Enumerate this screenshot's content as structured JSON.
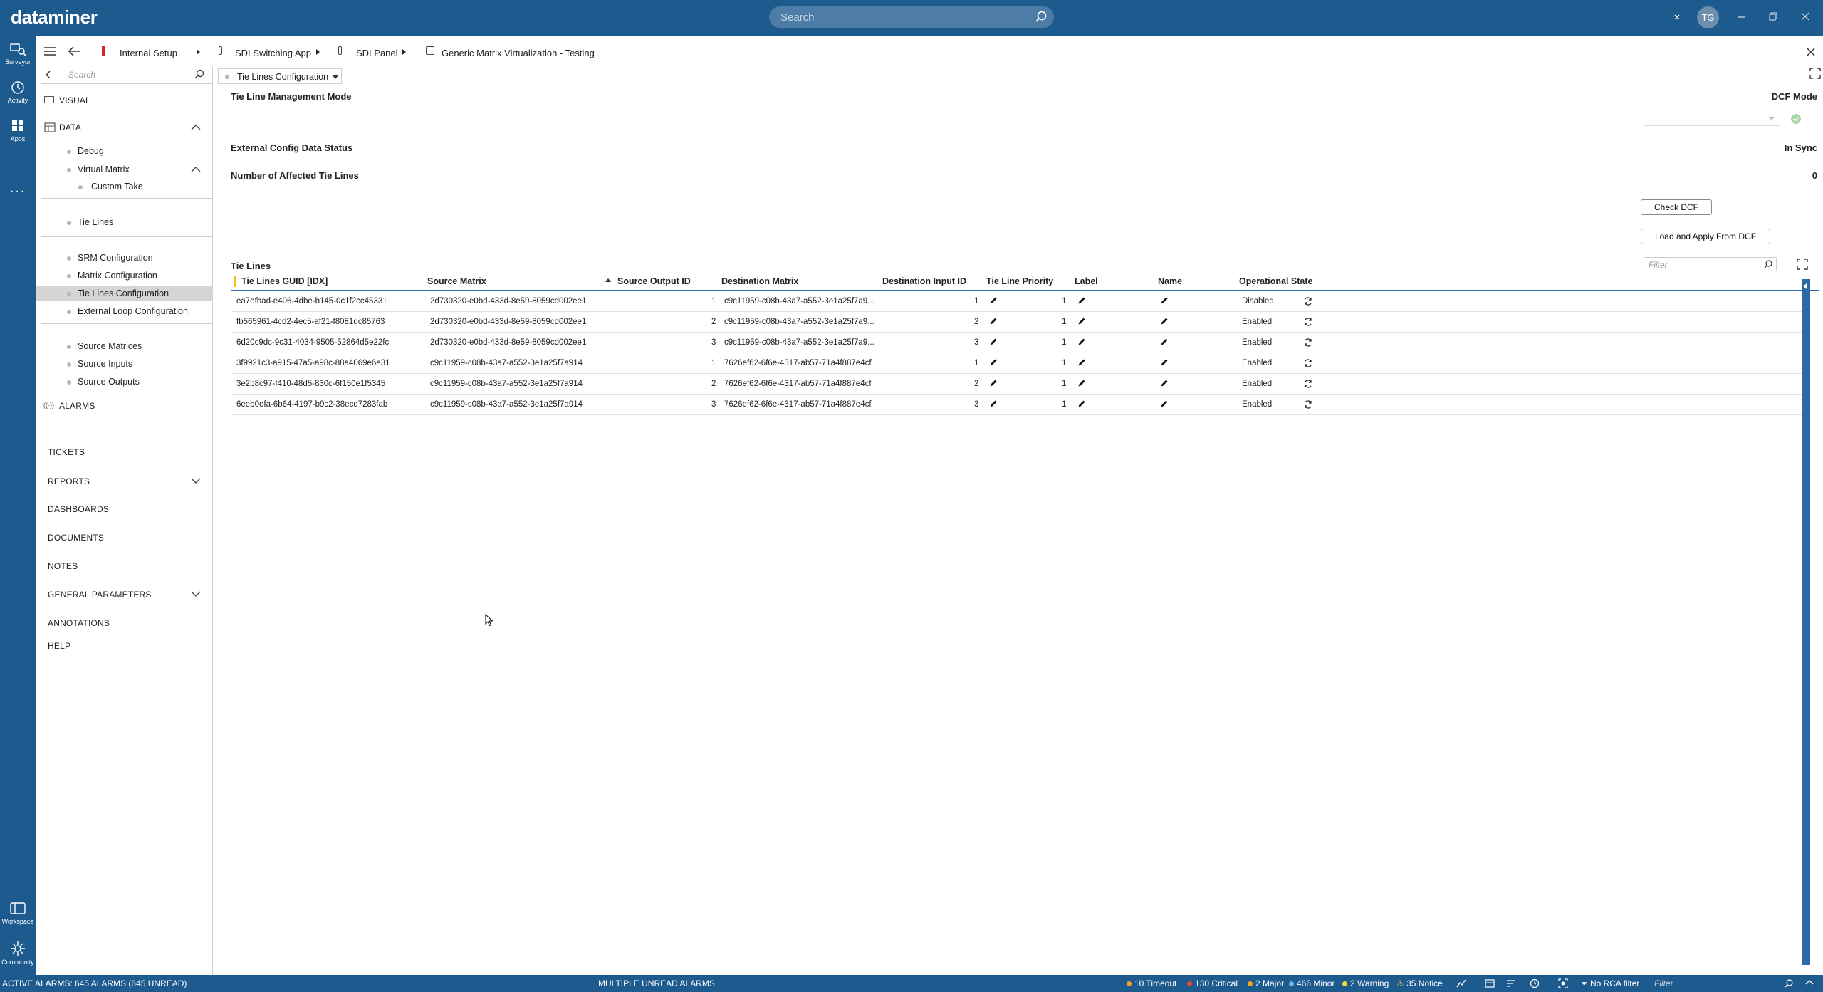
{
  "app": {
    "logo": "dataminer",
    "search_placeholder": "Search",
    "avatar_initials": "TG",
    "brand_color": "#1d5a8e"
  },
  "rail": {
    "items": [
      {
        "label": "Surveyor",
        "icon": "surveyor-icon"
      },
      {
        "label": "Activity",
        "icon": "activity-icon"
      },
      {
        "label": "Apps",
        "icon": "apps-icon"
      },
      {
        "label": "Workspace",
        "icon": "workspace-icon"
      },
      {
        "label": "Community",
        "icon": "community-icon"
      }
    ]
  },
  "breadcrumb": {
    "items": [
      "Internal Setup",
      "SDI Switching App",
      "SDI Panel",
      "Generic Matrix Virtualization - Testing"
    ]
  },
  "nav": {
    "search_placeholder": "Search",
    "visual": "VISUAL",
    "data": "DATA",
    "items": {
      "debug": "Debug",
      "virtual_matrix": "Virtual Matrix",
      "custom_take": "Custom Take",
      "tie_lines": "Tie Lines",
      "srm_configuration": "SRM Configuration",
      "matrix_configuration": "Matrix Configuration",
      "tie_lines_configuration": "Tie Lines Configuration",
      "external_loop_configuration": "External Loop Configuration",
      "source_matrices": "Source Matrices",
      "source_inputs": "Source Inputs",
      "source_outputs": "Source Outputs"
    },
    "alarms": "ALARMS",
    "sections": {
      "tickets": "TICKETS",
      "reports": "REPORTS",
      "dashboards": "DASHBOARDS",
      "documents": "DOCUMENTS",
      "notes": "NOTES",
      "general_parameters": "GENERAL PARAMETERS",
      "annotations": "ANNOTATIONS",
      "help": "HELP"
    }
  },
  "page": {
    "tab_dropdown": "Tie Lines Configuration",
    "fields": {
      "mode_label": "Tie Line Management Mode",
      "mode_value": "DCF Mode",
      "status_label": "External Config Data Status",
      "status_value": "In Sync",
      "affected_label": "Number of Affected Tie Lines",
      "affected_value": "0"
    },
    "buttons": {
      "check_dcf": "Check DCF",
      "load_apply": "Load and Apply From DCF"
    },
    "tie_lines_title": "Tie Lines",
    "filter_placeholder": "Filter"
  },
  "grid": {
    "columns": [
      "Tie Lines GUID [IDX]",
      "Source Matrix",
      "Source Output ID",
      "Destination Matrix",
      "Destination Input ID",
      "Tie Line Priority",
      "Label",
      "Name",
      "Operational State"
    ],
    "rows": [
      {
        "guid": "ea7efbad-e406-4dbe-b145-0c1f2cc45331",
        "source_matrix": "2d730320-e0bd-433d-8e59-8059cd002ee1",
        "source_output": "1",
        "dest_matrix": "c9c11959-c08b-43a7-a552-3e1a25f7a9...",
        "dest_input": "1",
        "priority": "1",
        "state": "Disabled"
      },
      {
        "guid": "fb565961-4cd2-4ec5-af21-f8081dc85763",
        "source_matrix": "2d730320-e0bd-433d-8e59-8059cd002ee1",
        "source_output": "2",
        "dest_matrix": "c9c11959-c08b-43a7-a552-3e1a25f7a9...",
        "dest_input": "2",
        "priority": "1",
        "state": "Enabled"
      },
      {
        "guid": "6d20c9dc-9c31-4034-9505-52864d5e22fc",
        "source_matrix": "2d730320-e0bd-433d-8e59-8059cd002ee1",
        "source_output": "3",
        "dest_matrix": "c9c11959-c08b-43a7-a552-3e1a25f7a9...",
        "dest_input": "3",
        "priority": "1",
        "state": "Enabled"
      },
      {
        "guid": "3f9921c3-a915-47a5-a98c-88a4069e6e31",
        "source_matrix": "c9c11959-c08b-43a7-a552-3e1a25f7a914",
        "source_output": "1",
        "dest_matrix": "7626ef62-6f6e-4317-ab57-71a4f887e4cf",
        "dest_input": "1",
        "priority": "1",
        "state": "Enabled"
      },
      {
        "guid": "3e2b8c97-f410-48d5-830c-6f150e1f5345",
        "source_matrix": "c9c11959-c08b-43a7-a552-3e1a25f7a914",
        "source_output": "2",
        "dest_matrix": "7626ef62-6f6e-4317-ab57-71a4f887e4cf",
        "dest_input": "2",
        "priority": "1",
        "state": "Enabled"
      },
      {
        "guid": "6eeb0efa-6b64-4197-b9c2-38ecd7283fab",
        "source_matrix": "c9c11959-c08b-43a7-a552-3e1a25f7a914",
        "source_output": "3",
        "dest_matrix": "7626ef62-6f6e-4317-ab57-71a4f887e4cf",
        "dest_input": "3",
        "priority": "1",
        "state": "Enabled"
      }
    ]
  },
  "statusbar": {
    "active_alarms": "ACTIVE ALARMS: 645 ALARMS (645 UNREAD)",
    "multiple_unread": "MULTIPLE UNREAD ALARMS",
    "timeout": "10 Timeout",
    "critical": "130 Critical",
    "major": "2 Major",
    "minor": "466 Minor",
    "warning": "2 Warning",
    "notice": "35 Notice",
    "rca": "No RCA filter",
    "filter_placeholder": "Filter",
    "colors": {
      "timeout": "#f0a32c",
      "critical": "#e8453c",
      "major": "#f3a21b",
      "minor": "#6fb5e8",
      "warning": "#f4d23c",
      "notice": "#f4d23c"
    }
  }
}
